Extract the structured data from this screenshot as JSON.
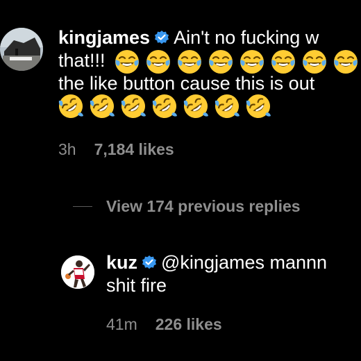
{
  "colors": {
    "background": "#000000",
    "text": "#ffffff",
    "muted": "#8e8e8e",
    "verified": "#3897f0"
  },
  "comments": [
    {
      "username": "kingjames",
      "verified": true,
      "lines": [
        "Ain't no fucking w",
        "that!!!",
        "the like button cause this is out"
      ],
      "emoji_line2": "face-with-tears-of-joy",
      "emoji_line4": "rolling-on-the-floor-laughing",
      "timestamp": "3h",
      "likes": "7,184 likes"
    },
    {
      "username": "kuz",
      "verified": true,
      "lines": [
        "@kingjames mannn",
        "shit fire"
      ],
      "timestamp": "41m",
      "likes": "226 likes"
    }
  ],
  "view_replies": {
    "label": "View 174 previous replies"
  }
}
